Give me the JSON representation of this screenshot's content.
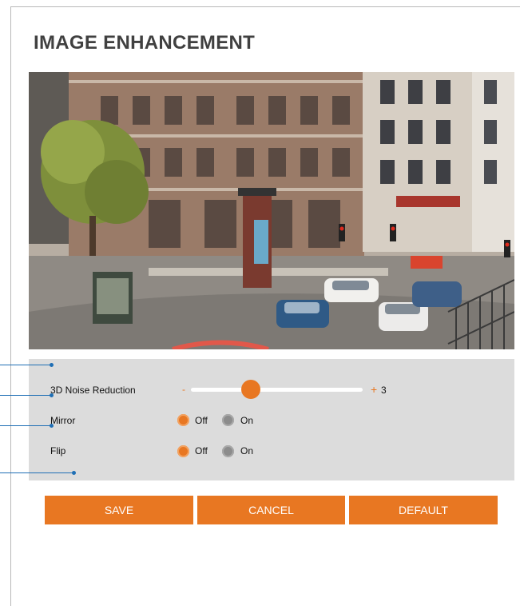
{
  "page": {
    "title": "IMAGE ENHANCEMENT"
  },
  "preview": {
    "description_icon": "camera-preview-image"
  },
  "settings": {
    "noise_reduction": {
      "label": "3D Noise Reduction",
      "minus": "-",
      "plus": "+",
      "value": "3",
      "level_fraction": 0.35
    },
    "mirror": {
      "label": "Mirror",
      "options": [
        "Off",
        "On"
      ],
      "selected": "Off"
    },
    "flip": {
      "label": "Flip",
      "options": [
        "Off",
        "On"
      ],
      "selected": "Off"
    }
  },
  "buttons": {
    "save": "SAVE",
    "cancel": "CANCEL",
    "default": "DEFAULT"
  },
  "colors": {
    "accent": "#e87722",
    "panel": "#dcdcdc",
    "callout": "#1f6fb5"
  }
}
